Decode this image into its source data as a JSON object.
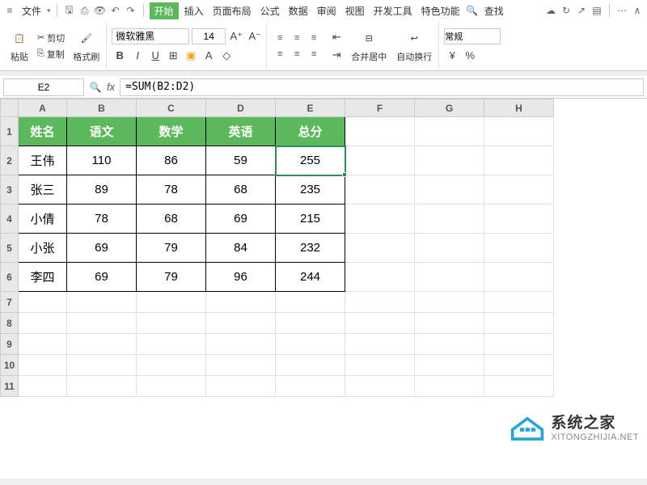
{
  "menu": {
    "file": "文件",
    "home": "开始",
    "insert": "插入",
    "page_layout": "页面布局",
    "formulas": "公式",
    "data": "数据",
    "review": "审阅",
    "view": "视图",
    "dev": "开发工具",
    "special": "特色功能",
    "search": "查找"
  },
  "ribbon": {
    "paste": "粘贴",
    "cut": "剪切",
    "copy": "复制",
    "format_painter": "格式刷",
    "font_name": "微软雅黑",
    "font_size": "14",
    "merge_center": "合并居中",
    "wrap_text": "自动换行",
    "number_format": "常规"
  },
  "formula_bar": {
    "cell_ref": "E2",
    "formula": "=SUM(B2:D2)"
  },
  "columns": [
    "A",
    "B",
    "C",
    "D",
    "E",
    "F",
    "G",
    "H"
  ],
  "table": {
    "headers": [
      "姓名",
      "语文",
      "数学",
      "英语",
      "总分"
    ],
    "rows": [
      {
        "name": "王伟",
        "chinese": "110",
        "math": "86",
        "english": "59",
        "total": "255"
      },
      {
        "name": "张三",
        "chinese": "89",
        "math": "78",
        "english": "68",
        "total": "235"
      },
      {
        "name": "小倩",
        "chinese": "78",
        "math": "68",
        "english": "69",
        "total": "215"
      },
      {
        "name": "小张",
        "chinese": "69",
        "math": "79",
        "english": "84",
        "total": "232"
      },
      {
        "name": "李四",
        "chinese": "69",
        "math": "79",
        "english": "96",
        "total": "244"
      }
    ]
  },
  "watermark": {
    "cn": "系统之家",
    "en": "XITONGZHIJIA.NET"
  }
}
